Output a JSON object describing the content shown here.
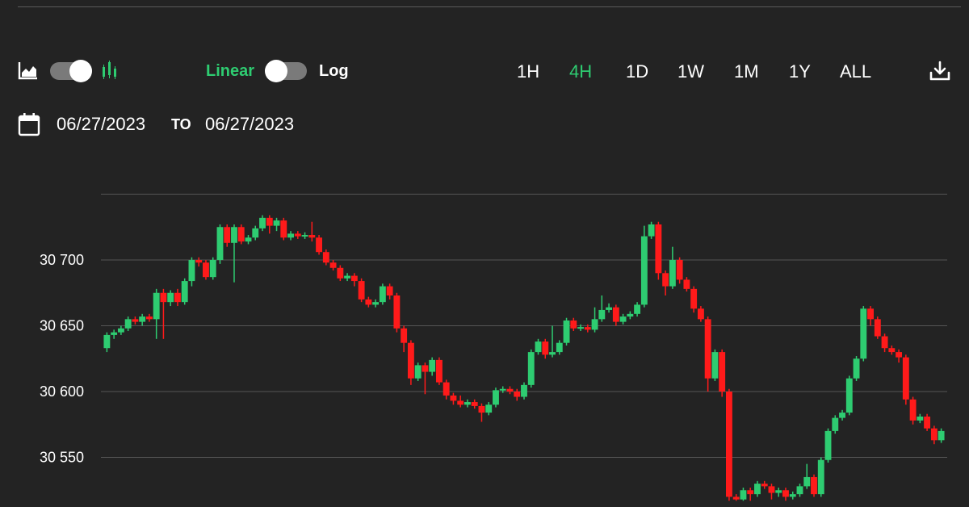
{
  "toolbar": {
    "chart_type_icons": [
      "area-chart-icon",
      "candlestick-chart-icon"
    ],
    "scale": {
      "linear_label": "Linear",
      "log_label": "Log",
      "selected": "Linear"
    },
    "ranges": [
      "1H",
      "4H",
      "1D",
      "1W",
      "1M",
      "1Y",
      "ALL"
    ],
    "active_range": "4H",
    "download_icon": "download-icon"
  },
  "date_range": {
    "icon": "calendar-icon",
    "from": "06/27/2023",
    "to_label": "TO",
    "to": "06/27/2023"
  },
  "colors": {
    "background": "#232323",
    "up": "#2ecc71",
    "down": "#ff1a1a",
    "accent": "#2ecc71",
    "grid": "#555555"
  },
  "chart_data": {
    "type": "candlestick",
    "grid": true,
    "ylim": [
      30517,
      30750
    ],
    "yticks": [
      {
        "value": 30700,
        "label": "30 700"
      },
      {
        "value": 30650,
        "label": "30 650"
      },
      {
        "value": 30600,
        "label": "30 600"
      },
      {
        "value": 30550,
        "label": "30 550"
      }
    ],
    "candles": [
      [
        30633,
        30643,
        30630,
        30645
      ],
      [
        30643,
        30645,
        30640,
        30647
      ],
      [
        30645,
        30648,
        30643,
        30650
      ],
      [
        30648,
        30655,
        30646,
        30657
      ],
      [
        30655,
        30653,
        30651,
        30657
      ],
      [
        30653,
        30657,
        30650,
        30659
      ],
      [
        30657,
        30655,
        30653,
        30659
      ],
      [
        30655,
        30675,
        30640,
        30678
      ],
      [
        30675,
        30668,
        30640,
        30678
      ],
      [
        30668,
        30675,
        30665,
        30677
      ],
      [
        30675,
        30668,
        30665,
        30678
      ],
      [
        30668,
        30684,
        30666,
        30686
      ],
      [
        30684,
        30700,
        30680,
        30702
      ],
      [
        30700,
        30698,
        30695,
        30702
      ],
      [
        30698,
        30687,
        30685,
        30700
      ],
      [
        30687,
        30700,
        30685,
        30702
      ],
      [
        30700,
        30725,
        30697,
        30727
      ],
      [
        30725,
        30713,
        30710,
        30727
      ],
      [
        30713,
        30725,
        30683,
        30727
      ],
      [
        30725,
        30714,
        30712,
        30727
      ],
      [
        30714,
        30717,
        30712,
        30719
      ],
      [
        30717,
        30724,
        30715,
        30726
      ],
      [
        30724,
        30732,
        30722,
        30734
      ],
      [
        30732,
        30726,
        30720,
        30734
      ],
      [
        30726,
        30730,
        30722,
        30732
      ],
      [
        30730,
        30717,
        30715,
        30732
      ],
      [
        30717,
        30720,
        30715,
        30722
      ],
      [
        30720,
        30718,
        30716,
        30722
      ],
      [
        30718,
        30719,
        30716,
        30721
      ],
      [
        30719,
        30717,
        30714,
        30729
      ],
      [
        30717,
        30706,
        30704,
        30719
      ],
      [
        30706,
        30698,
        30696,
        30708
      ],
      [
        30698,
        30694,
        30692,
        30700
      ],
      [
        30694,
        30686,
        30684,
        30696
      ],
      [
        30686,
        30688,
        30684,
        30690
      ],
      [
        30688,
        30684,
        30680,
        30690
      ],
      [
        30684,
        30670,
        30668,
        30686
      ],
      [
        30670,
        30666,
        30664,
        30672
      ],
      [
        30666,
        30668,
        30664,
        30670
      ],
      [
        30668,
        30680,
        30666,
        30682
      ],
      [
        30680,
        30673,
        30670,
        30682
      ],
      [
        30673,
        30648,
        30645,
        30675
      ],
      [
        30648,
        30637,
        30630,
        30650
      ],
      [
        30637,
        30610,
        30605,
        30639
      ],
      [
        30610,
        30620,
        30608,
        30622
      ],
      [
        30620,
        30615,
        30598,
        30622
      ],
      [
        30615,
        30624,
        30612,
        30626
      ],
      [
        30624,
        30607,
        30605,
        30626
      ],
      [
        30607,
        30597,
        30594,
        30609
      ],
      [
        30597,
        30593,
        30590,
        30599
      ],
      [
        30593,
        30590,
        30588,
        30597
      ],
      [
        30590,
        30592,
        30588,
        30594
      ],
      [
        30592,
        30589,
        30587,
        30594
      ],
      [
        30589,
        30584,
        30577,
        30591
      ],
      [
        30584,
        30590,
        30582,
        30592
      ],
      [
        30590,
        30601,
        30588,
        30603
      ],
      [
        30601,
        30602,
        30599,
        30604
      ],
      [
        30602,
        30600,
        30598,
        30604
      ],
      [
        30600,
        30596,
        30593,
        30602
      ],
      [
        30596,
        30605,
        30594,
        30607
      ],
      [
        30605,
        30630,
        30603,
        30632
      ],
      [
        30630,
        30638,
        30628,
        30640
      ],
      [
        30638,
        30628,
        30625,
        30640
      ],
      [
        30628,
        30630,
        30626,
        30650
      ],
      [
        30630,
        30637,
        30628,
        30639
      ],
      [
        30637,
        30654,
        30635,
        30656
      ],
      [
        30654,
        30648,
        30646,
        30656
      ],
      [
        30648,
        30649,
        30646,
        30651
      ],
      [
        30649,
        30647,
        30645,
        30651
      ],
      [
        30647,
        30655,
        30645,
        30664
      ],
      [
        30655,
        30662,
        30653,
        30673
      ],
      [
        30662,
        30664,
        30660,
        30667
      ],
      [
        30664,
        30653,
        30650,
        30666
      ],
      [
        30653,
        30657,
        30651,
        30659
      ],
      [
        30657,
        30659,
        30655,
        30661
      ],
      [
        30659,
        30666,
        30657,
        30668
      ],
      [
        30666,
        30718,
        30664,
        30726
      ],
      [
        30718,
        30727,
        30716,
        30729
      ],
      [
        30727,
        30690,
        30685,
        30729
      ],
      [
        30690,
        30680,
        30673,
        30692
      ],
      [
        30680,
        30700,
        30678,
        30710
      ],
      [
        30700,
        30685,
        30682,
        30702
      ],
      [
        30685,
        30678,
        30676,
        30687
      ],
      [
        30678,
        30663,
        30660,
        30680
      ],
      [
        30663,
        30655,
        30653,
        30665
      ],
      [
        30655,
        30610,
        30600,
        30657
      ],
      [
        30610,
        30630,
        30608,
        30632
      ],
      [
        30630,
        30600,
        30596,
        30632
      ],
      [
        30600,
        30520,
        30517,
        30602
      ],
      [
        30520,
        30518,
        30517,
        30522
      ],
      [
        30518,
        30525,
        30517,
        30527
      ],
      [
        30525,
        30522,
        30517,
        30527
      ],
      [
        30522,
        30530,
        30520,
        30532
      ],
      [
        30530,
        30528,
        30526,
        30532
      ],
      [
        30528,
        30523,
        30518,
        30530
      ],
      [
        30523,
        30525,
        30520,
        30527
      ],
      [
        30525,
        30520,
        30517,
        30527
      ],
      [
        30520,
        30522,
        30518,
        30524
      ],
      [
        30522,
        30528,
        30520,
        30530
      ],
      [
        30528,
        30535,
        30526,
        30545
      ],
      [
        30535,
        30522,
        30520,
        30537
      ],
      [
        30522,
        30548,
        30520,
        30550
      ],
      [
        30548,
        30570,
        30546,
        30572
      ],
      [
        30570,
        30580,
        30568,
        30582
      ],
      [
        30580,
        30584,
        30578,
        30586
      ],
      [
        30584,
        30610,
        30582,
        30612
      ],
      [
        30610,
        30625,
        30608,
        30627
      ],
      [
        30625,
        30663,
        30623,
        30665
      ],
      [
        30663,
        30655,
        30650,
        30665
      ],
      [
        30655,
        30642,
        30640,
        30657
      ],
      [
        30642,
        30633,
        30630,
        30644
      ],
      [
        30633,
        30630,
        30628,
        30635
      ],
      [
        30630,
        30626,
        30622,
        30632
      ],
      [
        30626,
        30594,
        30590,
        30628
      ],
      [
        30594,
        30578,
        30575,
        30596
      ],
      [
        30578,
        30581,
        30576,
        30583
      ],
      [
        30581,
        30572,
        30570,
        30583
      ],
      [
        30572,
        30563,
        30560,
        30574
      ],
      [
        30563,
        30570,
        30561,
        30572
      ]
    ]
  }
}
